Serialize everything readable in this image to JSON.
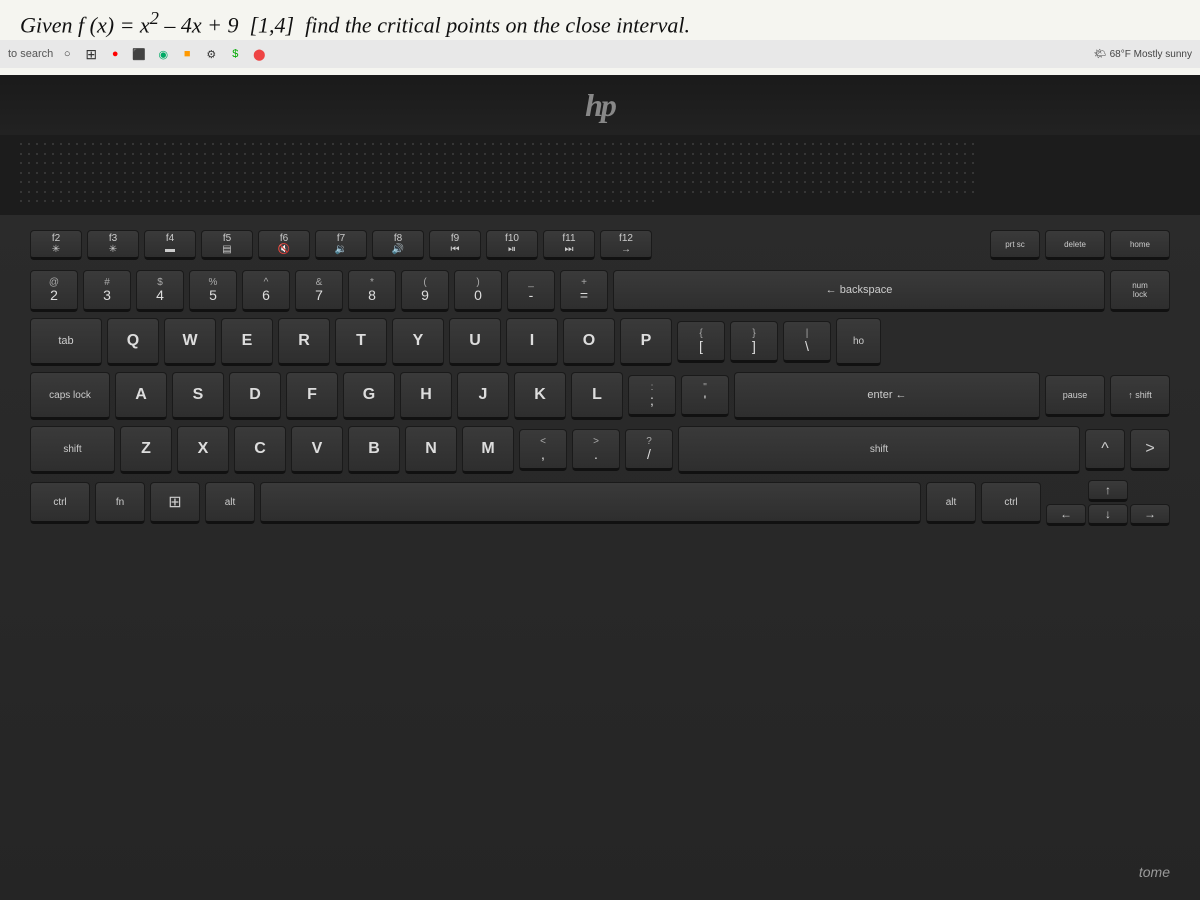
{
  "screen": {
    "math_text": "Given f(x) = x² – 4x + 9  [1,4]  find the critical points on the close interval.",
    "taskbar": {
      "search_placeholder": "to search",
      "weather": "68°F  Mostly sunny",
      "icons": [
        "○",
        "⊞",
        "●",
        "⊟",
        "■",
        "◉",
        "⊞",
        "✦",
        "$",
        "⬤"
      ]
    }
  },
  "laptop": {
    "hp_logo": "hp",
    "keyboard": {
      "fn_row": [
        {
          "label": "f2",
          "icon": "*"
        },
        {
          "label": "f3",
          "icon": "✳"
        },
        {
          "label": "f4",
          "icon": "⬛"
        },
        {
          "label": "f5",
          "icon": "▤"
        },
        {
          "label": "f6",
          "icon": "🔇"
        },
        {
          "label": "f7",
          "icon": "🔉"
        },
        {
          "label": "f8",
          "icon": "🔊"
        },
        {
          "label": "f9",
          "icon": "⏮"
        },
        {
          "label": "f10",
          "icon": "⏯"
        },
        {
          "label": "f11",
          "icon": "⏭"
        },
        {
          "label": "f12",
          "icon": "→"
        },
        {
          "label": "prt sc"
        },
        {
          "label": "delete"
        },
        {
          "label": "home"
        },
        {
          "label": "num lock"
        }
      ],
      "num_row": [
        "@2",
        "#3",
        "$4",
        "%5",
        "^6",
        "&7",
        "*8",
        "(9",
        ")0",
        "-",
        "=",
        "backspace"
      ],
      "qwerty": [
        "Q",
        "W",
        "E",
        "R",
        "T",
        "Y",
        "U",
        "I",
        "O",
        "P"
      ],
      "asdf": [
        "A",
        "S",
        "D",
        "F",
        "G",
        "H",
        "J",
        "K",
        "L"
      ],
      "zxcv": [
        "Z",
        "X",
        "C",
        "V",
        "B",
        "N",
        "M"
      ]
    }
  }
}
